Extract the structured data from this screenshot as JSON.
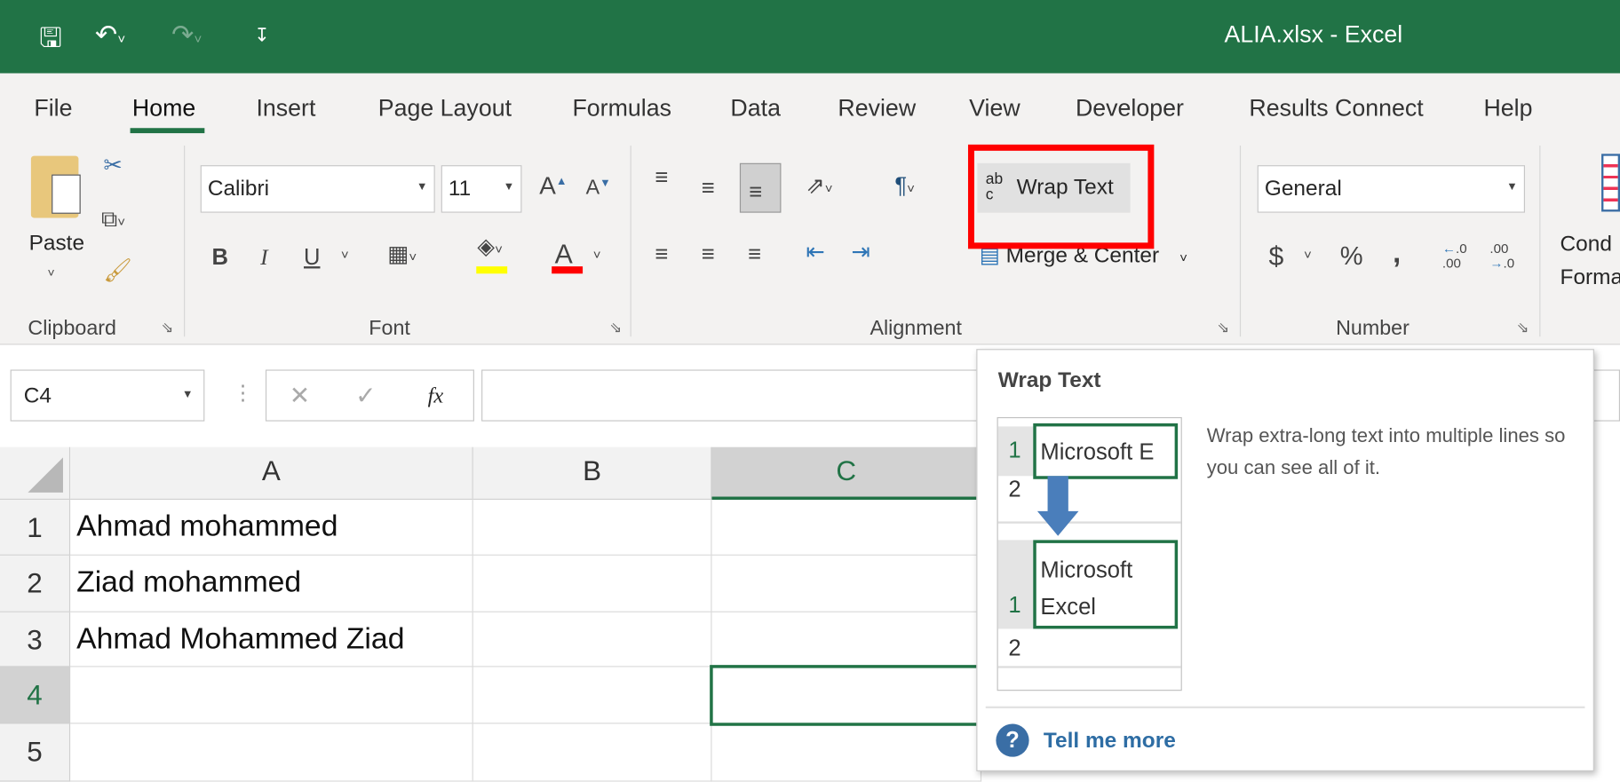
{
  "titlebar": {
    "title": "ALIA.xlsx  -  Excel",
    "icons": [
      "save-icon",
      "undo-icon",
      "redo-icon",
      "customize-quick-access-icon"
    ]
  },
  "tabs": [
    "File",
    "Home",
    "Insert",
    "Page Layout",
    "Formulas",
    "Data",
    "Review",
    "View",
    "Developer",
    "Results Connect",
    "Help"
  ],
  "active_tab": "Home",
  "ribbon": {
    "clipboard": {
      "label": "Clipboard",
      "paste": "Paste"
    },
    "font": {
      "label": "Font",
      "name": "Calibri",
      "size": "11",
      "bold": "B",
      "italic": "I",
      "underline": "U",
      "font_color_letter": "A",
      "highlight_color": "#ffff00",
      "font_color": "#ff0000"
    },
    "alignment": {
      "label": "Alignment",
      "wrap_text": "Wrap Text",
      "merge_center": "Merge & Center",
      "wrap_icon_text": "ab c"
    },
    "number": {
      "label": "Number",
      "format": "General",
      "currency": "$",
      "percent": "%",
      "comma": ","
    },
    "styles": {
      "conditional_formatting_partial": [
        "Cond",
        "Forma"
      ]
    }
  },
  "highlight_color": "#ff0000",
  "formula_bar": {
    "name_box": "C4",
    "cancel": "✕",
    "enter": "✓",
    "fx": "fx",
    "value": ""
  },
  "sheet": {
    "columns": [
      "A",
      "B",
      "C"
    ],
    "selected_column": "C",
    "rows": [
      {
        "n": "1",
        "A": "Ahmad mohammed"
      },
      {
        "n": "2",
        "A": "Ziad mohammed"
      },
      {
        "n": "3",
        "A": "Ahmad Mohammed Ziad"
      },
      {
        "n": "4",
        "A": ""
      },
      {
        "n": "5",
        "A": ""
      }
    ],
    "selected_cell": "C4"
  },
  "tooltip": {
    "title": "Wrap Text",
    "description": "Wrap extra-long text into multiple lines so you can see all of it.",
    "illustration": {
      "before": "Microsoft E",
      "after_line1": "Microsoft",
      "after_line2": "Excel",
      "row1": "1",
      "row2": "2"
    },
    "link": "Tell me more"
  }
}
